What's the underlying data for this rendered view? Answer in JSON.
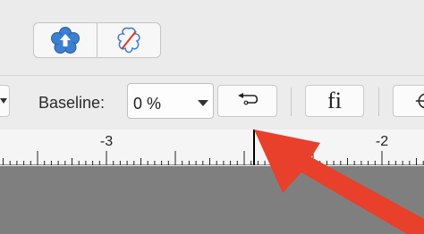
{
  "header": {
    "segment_buttons": [
      {
        "icon": "flower-upload-icon",
        "color": "#3d7fd0"
      },
      {
        "icon": "flower-clear-icon",
        "color": "#3d7fd0",
        "slash_color": "#d93a2b"
      }
    ]
  },
  "toolbar": {
    "baseline_label": "Baseline:",
    "baseline_value": "0 %",
    "buttons": [
      {
        "icon": "return-arrow-icon"
      },
      {
        "icon": "ligature-icon",
        "glyph": "fi"
      },
      {
        "icon": "crosshair-icon"
      }
    ]
  },
  "ruler": {
    "labels": [
      "-3",
      "-2"
    ]
  },
  "colors": {
    "accent": "#3d7fd0",
    "annotation_arrow": "#e8402a",
    "canvas": "#7f7f7f"
  }
}
